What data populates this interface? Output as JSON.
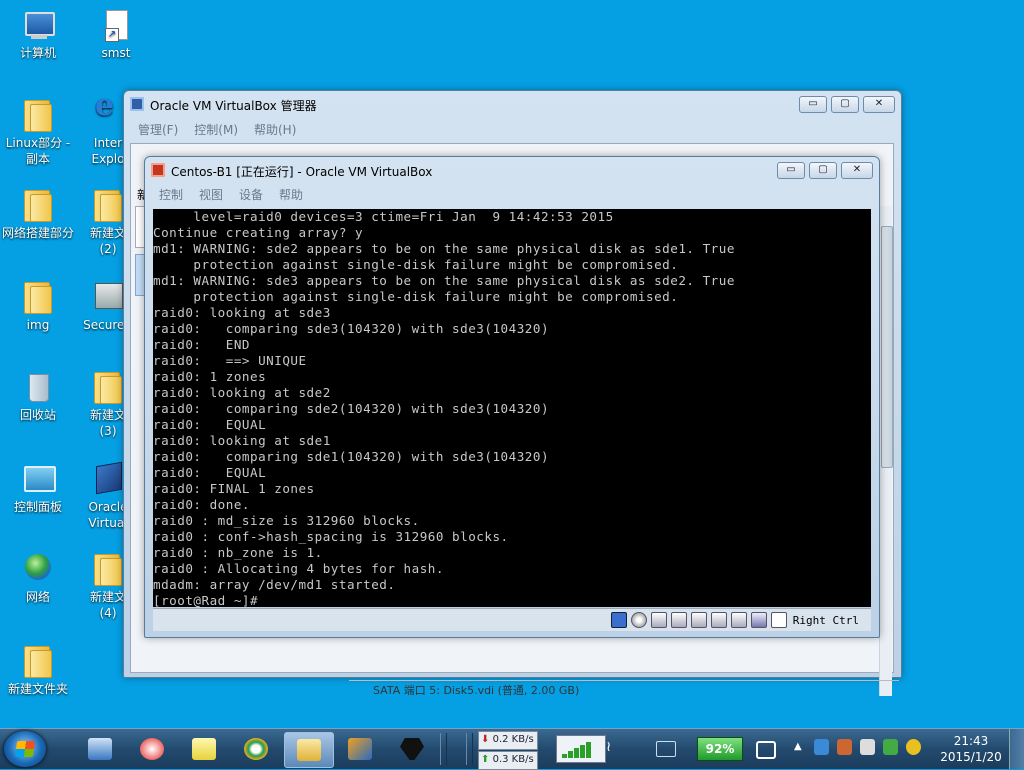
{
  "desktop": {
    "icons": [
      {
        "label": "计算机"
      },
      {
        "label": "smst"
      },
      {
        "label": "Linux部分 -",
        "label2": "副本"
      },
      {
        "label": "Inter",
        "label2": "Explo"
      },
      {
        "label": "网络搭建部分"
      },
      {
        "label": "新建文",
        "label2": "(2)"
      },
      {
        "label": "img"
      },
      {
        "label": "SecureC"
      },
      {
        "label": "回收站"
      },
      {
        "label": "新建文",
        "label2": "(3)"
      },
      {
        "label": "控制面板"
      },
      {
        "label": "Oracle",
        "label2": "Virtual"
      },
      {
        "label": "网络"
      },
      {
        "label": "新建文",
        "label2": "(4)"
      },
      {
        "label": "新建文件夹"
      }
    ]
  },
  "manager_window": {
    "title": "Oracle VM VirtualBox 管理器",
    "menu": [
      "管理(F)",
      "控制(M)",
      "帮助(H)"
    ],
    "controls": {
      "minimize": "▭",
      "maximize": "▢",
      "close": "✕"
    },
    "peek_text": "新",
    "bottom_text": "SATA 端口 5:         Disk5.vdi (普通, 2.00 GB)"
  },
  "vm_window": {
    "title": "Centos-B1 [正在运行] - Oracle VM VirtualBox",
    "menu": [
      "控制",
      "视图",
      "设备",
      "帮助"
    ],
    "controls": {
      "minimize": "▭",
      "maximize": "▢",
      "close": "✕"
    },
    "console_lines": [
      "     level=raid0 devices=3 ctime=Fri Jan  9 14:42:53 2015",
      "Continue creating array? y",
      "md1: WARNING: sde2 appears to be on the same physical disk as sde1. True",
      "     protection against single-disk failure might be compromised.",
      "md1: WARNING: sde3 appears to be on the same physical disk as sde2. True",
      "     protection against single-disk failure might be compromised.",
      "raid0: looking at sde3",
      "raid0:   comparing sde3(104320) with sde3(104320)",
      "raid0:   END",
      "raid0:   ==> UNIQUE",
      "raid0: 1 zones",
      "raid0: looking at sde2",
      "raid0:   comparing sde2(104320) with sde3(104320)",
      "raid0:   EQUAL",
      "raid0: looking at sde1",
      "raid0:   comparing sde1(104320) with sde3(104320)",
      "raid0:   EQUAL",
      "raid0: FINAL 1 zones",
      "raid0: done.",
      "raid0 : md_size is 312960 blocks.",
      "raid0 : conf->hash_spacing is 312960 blocks.",
      "raid0 : nb_zone is 1.",
      "raid0 : Allocating 4 bytes for hash.",
      "mdadm: array /dev/md1 started.",
      "[root@Rad ~]# _"
    ],
    "status": {
      "host_key": "Right Ctrl",
      "icons": [
        "hard-disk-icon",
        "optical-drive-icon",
        "usb-icon",
        "shared-folder-icon",
        "network-icon",
        "display-icon",
        "capture-icon",
        "mouse-integration-icon",
        "download-icon"
      ]
    }
  },
  "taskbar": {
    "net_down": "0.2 KB/s",
    "net_up": "0.3 KB/s",
    "net_down_arrow": "⬇",
    "net_up_arrow": "⬆",
    "battery": "92%",
    "time": "21:43",
    "date": "2015/1/20",
    "tray_expand": "▲"
  },
  "colors": {
    "desktop": "#05a0e4",
    "console_bg": "#000000",
    "console_fg": "#c8c8c8"
  }
}
